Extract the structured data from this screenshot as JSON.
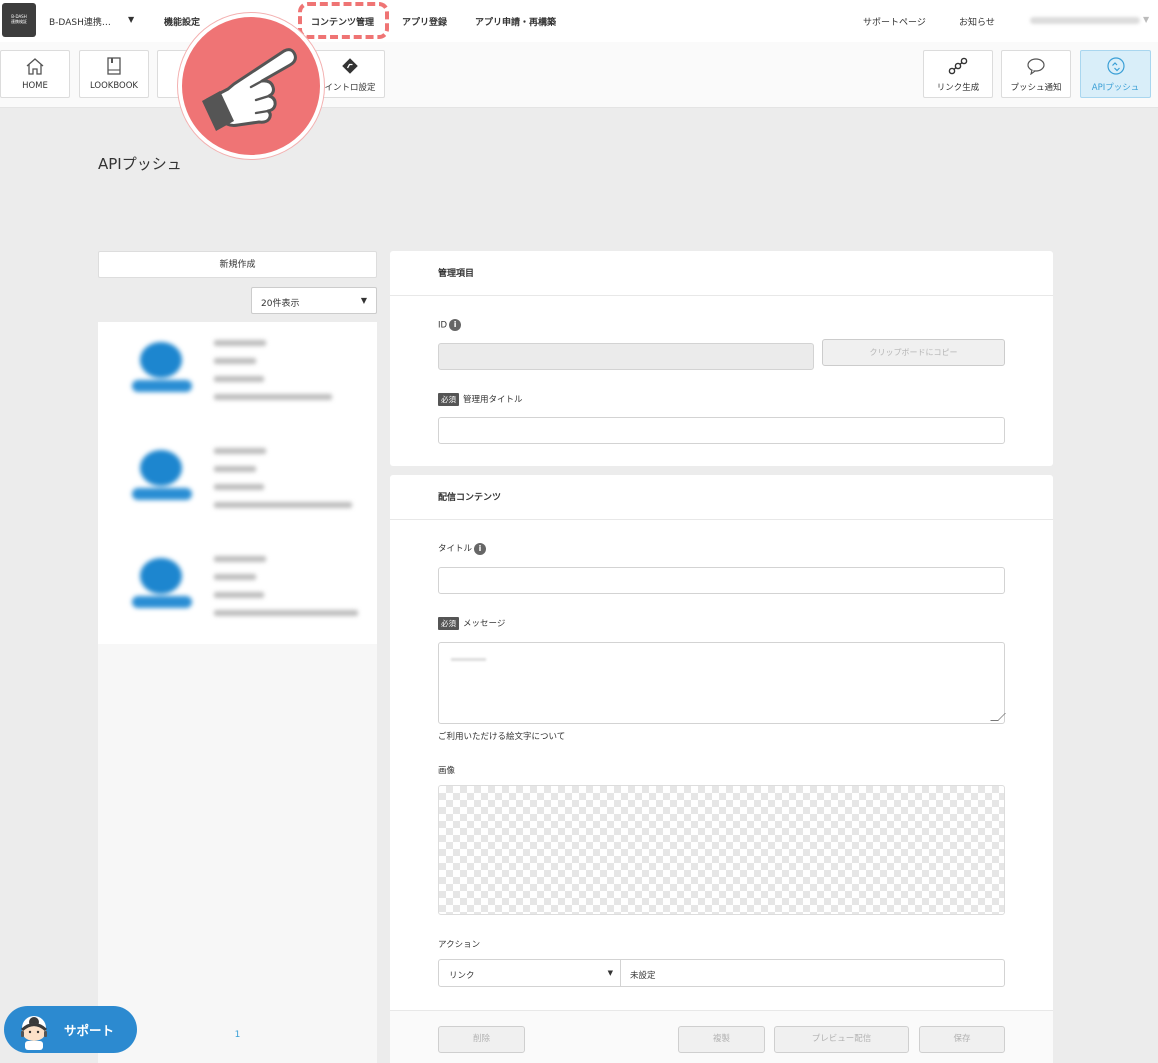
{
  "topnav": {
    "logo_text": "B-DASH 連携検証",
    "project_name": "B-DASH連携…",
    "menu": [
      "機能設定",
      "コンテンツ管理",
      "アプリ登録",
      "アプリ申請・再構築"
    ],
    "support_page": "サポートページ",
    "news": "お知らせ"
  },
  "toolbar": {
    "left": [
      {
        "label": "HOME",
        "icon": "home-icon"
      },
      {
        "label": "LOOKBOOK",
        "icon": "book-icon"
      },
      {
        "label": "",
        "icon": "blank"
      },
      {
        "label": "",
        "icon": "blank"
      },
      {
        "label": "イントロ設定",
        "icon": "intro-icon"
      }
    ],
    "right": [
      {
        "label": "リンク生成",
        "icon": "link-nodes-icon"
      },
      {
        "label": "プッシュ通知",
        "icon": "speech-bubble-icon"
      },
      {
        "label": "APIプッシュ",
        "icon": "api-push-icon",
        "active": true
      }
    ]
  },
  "page": {
    "title": "APIプッシュ"
  },
  "list": {
    "new_button": "新規作成",
    "per_page": "20件表示",
    "page_number": "1",
    "item_count": 3
  },
  "manage": {
    "header": "管理項目",
    "id_label": "ID",
    "copy_button": "クリップボードにコピー",
    "required_badge": "必須",
    "title_label": "管理用タイトル"
  },
  "content": {
    "header": "配信コンテンツ",
    "title_label": "タイトル",
    "required_badge": "必須",
    "message_label": "メッセージ",
    "emoji_note": "ご利用いただける絵文字について",
    "image_label": "画像",
    "action_label": "アクション",
    "action_type": "リンク",
    "action_value": "未設定"
  },
  "footer": {
    "delete": "削除",
    "duplicate": "複製",
    "preview": "プレビュー配信",
    "save": "保存"
  },
  "support": {
    "label": "サポート"
  },
  "colors": {
    "accent": "#3a9fd6",
    "highlight": "#ef7475",
    "support": "#2c8ad0"
  }
}
